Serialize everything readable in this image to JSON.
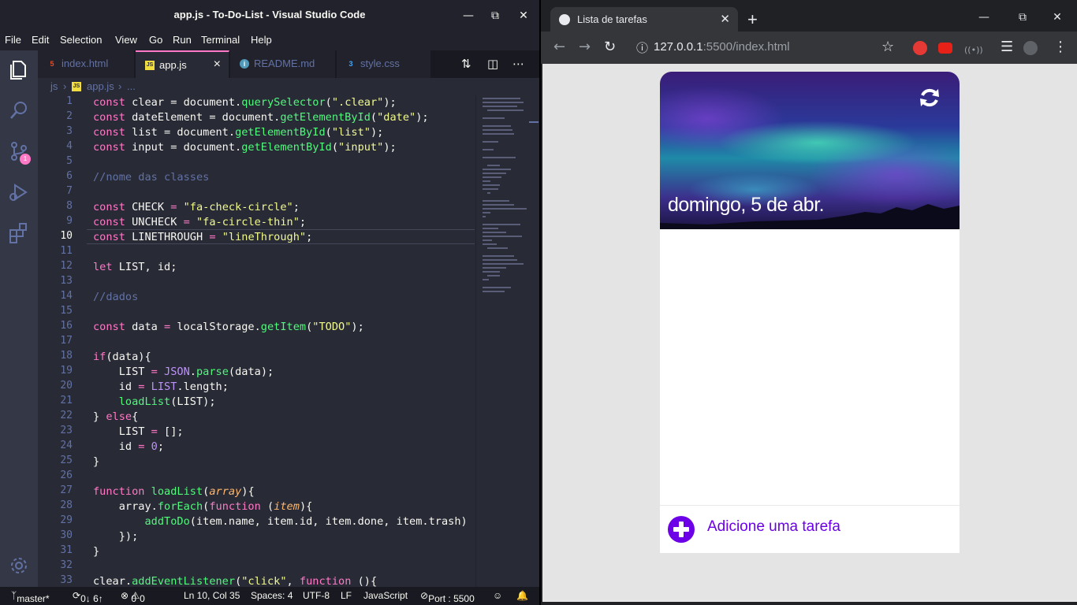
{
  "vscode": {
    "window_title": "app.js - To-Do-List - Visual Studio Code",
    "menu": [
      "File",
      "Edit",
      "Selection",
      "View",
      "Go",
      "Run",
      "Terminal",
      "Help"
    ],
    "tabs": [
      {
        "label": "index.html",
        "icon": "html5-icon"
      },
      {
        "label": "app.js",
        "icon": "js-icon",
        "active": true
      },
      {
        "label": "README.md",
        "icon": "info-icon"
      },
      {
        "label": "style.css",
        "icon": "css3-icon"
      }
    ],
    "breadcrumb": {
      "folder": "js",
      "file": "app.js",
      "more": "..."
    },
    "source_control_badge": "1",
    "line_numbers": [
      "1",
      "2",
      "3",
      "4",
      "5",
      "6",
      "7",
      "8",
      "9",
      "10",
      "11",
      "12",
      "13",
      "14",
      "15",
      "16",
      "17",
      "18",
      "19",
      "20",
      "21",
      "22",
      "23",
      "24",
      "25",
      "26",
      "27",
      "28",
      "29",
      "30",
      "31",
      "32",
      "33"
    ],
    "current_line": "10",
    "status": {
      "branch": "master*",
      "sync": "0↓ 6↑",
      "problems": "0",
      "warnings": "0",
      "position": "Ln 10, Col 35",
      "spaces": "Spaces: 4",
      "encoding": "UTF-8",
      "eol": "LF",
      "language": "JavaScript",
      "port": "Port : 5500"
    }
  },
  "chrome": {
    "tab_title": "Lista de tarefas",
    "url_host": "127.0.0.1",
    "url_rest": ":5500/index.html",
    "app": {
      "date": "domingo, 5 de abr.",
      "add_placeholder": "Adicione uma tarefa"
    }
  }
}
